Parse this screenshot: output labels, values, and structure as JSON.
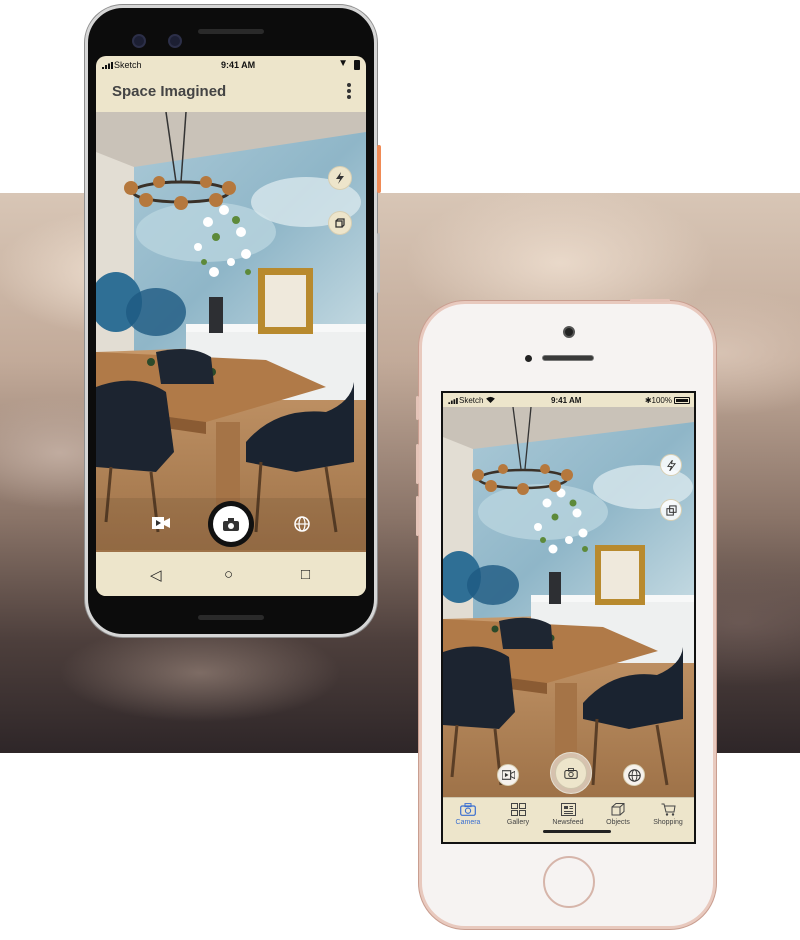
{
  "android": {
    "status": {
      "carrier": "Sketch",
      "time": "9:41 AM"
    },
    "app_title": "Space Imagined",
    "menu_icon": "overflow-menu-icon",
    "side_tools": [
      "flash-icon",
      "cube-icon"
    ],
    "capture_tools": [
      "video-icon",
      "camera-icon",
      "globe-icon"
    ],
    "nav": [
      "back-icon",
      "home-icon",
      "recents-icon"
    ],
    "accent": "#ede5cb"
  },
  "iphone": {
    "status": {
      "carrier": "Sketch",
      "time": "9:41 AM",
      "battery": "100%"
    },
    "side_tools": [
      "flash-icon",
      "layers-icon"
    ],
    "capture_tools": [
      "video-icon",
      "camera-icon",
      "globe-icon"
    ],
    "tabs": [
      {
        "label": "Camera",
        "icon": "camera-icon",
        "active": true
      },
      {
        "label": "Gallery",
        "icon": "grid-icon",
        "active": false
      },
      {
        "label": "Newsfeed",
        "icon": "newsfeed-icon",
        "active": false
      },
      {
        "label": "Objects",
        "icon": "cube-icon",
        "active": false
      },
      {
        "label": "Shopping",
        "icon": "cart-icon",
        "active": false
      }
    ],
    "active_color": "#3a6fd0"
  }
}
